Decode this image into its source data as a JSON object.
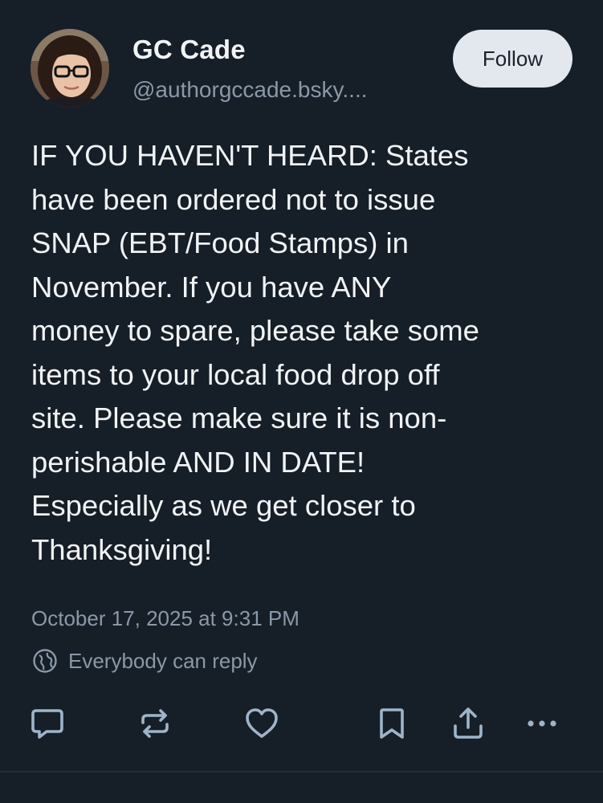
{
  "author": {
    "name": "GC Cade",
    "handle": "@authorgccade.bsky...."
  },
  "follow_label": "Follow",
  "post": {
    "text": "IF YOU HAVEN'T HEARD: States\nhave been ordered not to issue\nSNAP (EBT/Food Stamps) in\nNovember. If you have ANY\nmoney to spare, please take some\nitems to your local food drop off\nsite. Please make sure it is non-\nperishable AND IN DATE!\nEspecially as we get closer to\nThanksgiving!",
    "timestamp": "October 17, 2025 at 9:31 PM",
    "reply_setting": "Everybody can reply"
  },
  "actions": {
    "icons": [
      "reply-icon",
      "repost-icon",
      "like-icon",
      "bookmark-icon",
      "share-icon",
      "more-icon"
    ]
  },
  "colors": {
    "background": "#161e27",
    "text": "#f1f3f5",
    "muted": "#8a98a8",
    "icon": "#9fb4c9",
    "follow_bg": "#e3e8ee"
  }
}
